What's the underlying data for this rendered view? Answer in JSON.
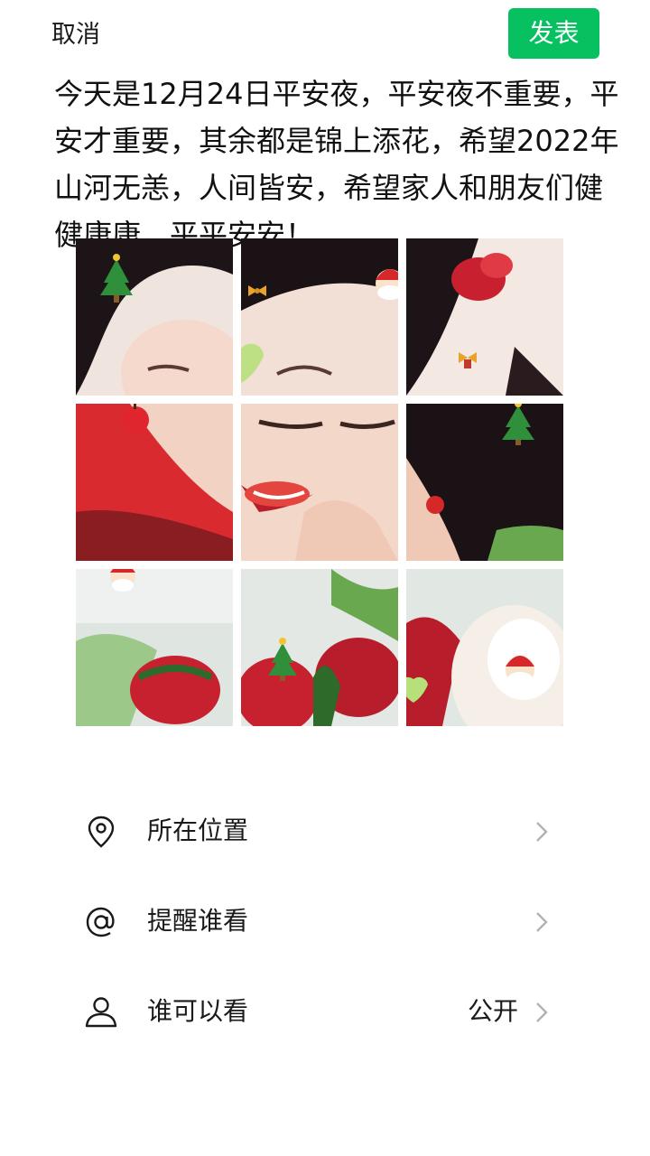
{
  "topbar": {
    "cancel_label": "取消",
    "publish_label": "发表",
    "publish_color": "#07c160"
  },
  "post": {
    "text": "今天是12月24日平安夜，平安夜不重要，平安才重要，其余都是锦上添花，希望2022年山河无恙，人间皆安，希望家人和朋友们健健康康，平平安安！"
  },
  "photos": {
    "count": 9,
    "tiles": [
      {
        "desc": "photo-1"
      },
      {
        "desc": "photo-2"
      },
      {
        "desc": "photo-3"
      },
      {
        "desc": "photo-4"
      },
      {
        "desc": "photo-5"
      },
      {
        "desc": "photo-6"
      },
      {
        "desc": "photo-7"
      },
      {
        "desc": "photo-8"
      },
      {
        "desc": "photo-9"
      }
    ]
  },
  "options": {
    "location": {
      "label": "所在位置",
      "icon": "location-pin-icon"
    },
    "mention": {
      "label": "提醒谁看",
      "icon": "at-sign-icon"
    },
    "visibility": {
      "label": "谁可以看",
      "value": "公开",
      "icon": "person-icon"
    }
  }
}
